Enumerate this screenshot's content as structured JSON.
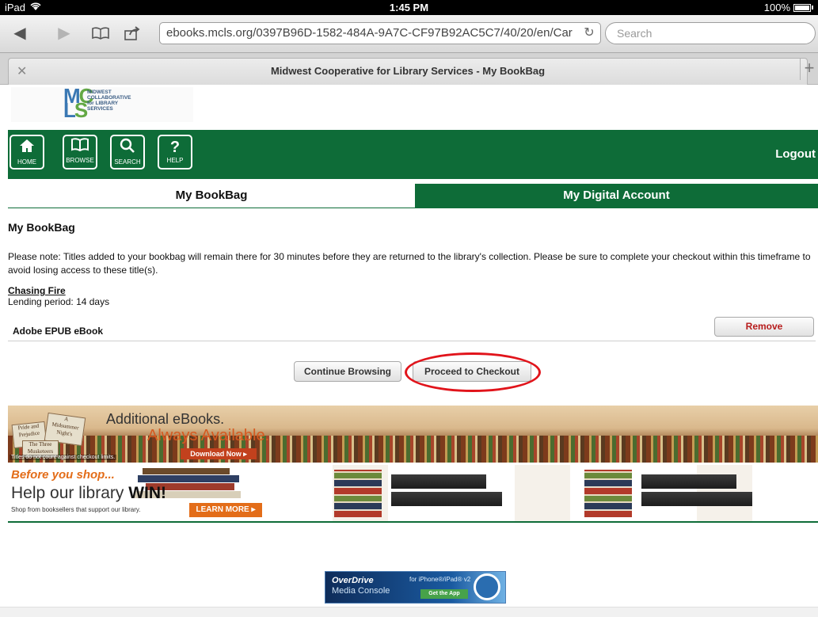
{
  "status_bar": {
    "device": "iPad",
    "time": "1:45 PM",
    "battery": "100%"
  },
  "browser": {
    "url": "ebooks.mcls.org/0397B96D-1582-484A-9A7C-CF97B92AC5C7/40/20/en/Car",
    "search_placeholder": "Search",
    "tab_title": "Midwest Cooperative for Library Services - My BookBag"
  },
  "logo": {
    "lines": [
      "MIDWEST",
      "COLLABORATIVE",
      "for LIBRARY",
      "SERVICES"
    ]
  },
  "nav": {
    "items": [
      {
        "label": "HOME",
        "icon": "home-icon"
      },
      {
        "label": "BROWSE",
        "icon": "book-icon"
      },
      {
        "label": "SEARCH",
        "icon": "search-icon"
      },
      {
        "label": "HELP",
        "icon": "help-icon"
      }
    ],
    "logout": "Logout"
  },
  "tabs": {
    "bookbag": "My BookBag",
    "account": "My Digital Account"
  },
  "page": {
    "heading": "My BookBag",
    "note": "Please note: Titles added to your bookbag will remain there for 30 minutes before they are returned to the library's collection. Please be sure to complete your checkout within this timeframe to avoid losing access to these title(s).",
    "item": {
      "title": "Chasing Fire",
      "lending": "Lending period: 14 days",
      "format": "Adobe EPUB eBook",
      "remove": "Remove"
    },
    "buttons": {
      "continue": "Continue Browsing",
      "proceed": "Proceed to Checkout"
    }
  },
  "banner_ebooks": {
    "title": "Additional eBooks.",
    "subtitle": "Always Available.",
    "cta": "Download Now ▸",
    "note": "Titles do not count against checkout limits."
  },
  "banner_shop": {
    "kicker": "Before you shop...",
    "headline_start": "Help our library ",
    "headline_bold": "WIN!",
    "note": "Shop from booksellers that support our library.",
    "cta": "LEARN MORE ▸"
  },
  "overdrive": {
    "brand": "OverDrive",
    "product": "Media Console",
    "device": "for iPhone®/iPad® v2",
    "cta": "Get the App"
  },
  "colors": {
    "brand_green": "#0e6c38",
    "highlight_red": "#e1141b",
    "remove_red": "#b71c1c"
  }
}
